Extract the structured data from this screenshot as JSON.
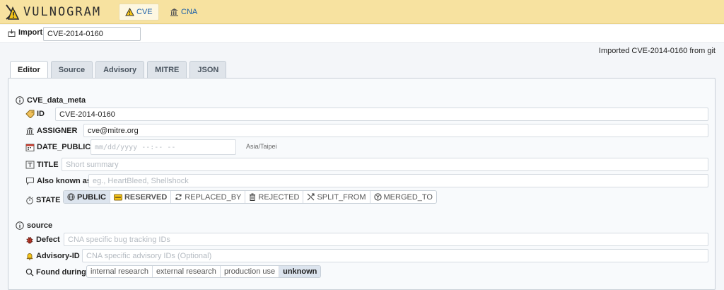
{
  "app": {
    "brand": "VULNOGRAM"
  },
  "nav": [
    {
      "label": "CVE",
      "icon": "warning-icon"
    },
    {
      "label": "CNA",
      "icon": "building-icon"
    }
  ],
  "import": {
    "label": "Import",
    "value": "CVE-2014-0160"
  },
  "status": "Imported CVE-2014-0160 from git",
  "tabs": [
    "Editor",
    "Source",
    "Advisory",
    "MITRE",
    "JSON"
  ],
  "cve_data_meta": {
    "title": "CVE_data_meta",
    "id": {
      "label": "ID",
      "value": "CVE-2014-0160"
    },
    "assigner": {
      "label": "ASSIGNER",
      "value": "cve@mitre.org"
    },
    "date_public": {
      "label": "DATE_PUBLIC",
      "placeholder": "mm/dd/yyyy --:-- --",
      "timezone": "Asia/Taipei"
    },
    "title_field": {
      "label": "TITLE",
      "placeholder": "Short summary"
    },
    "aka": {
      "label": "Also known as",
      "placeholder": "eg., HeartBleed, Shellshock"
    },
    "state": {
      "label": "STATE",
      "options": [
        "PUBLIC",
        "RESERVED",
        "REPLACED_BY",
        "REJECTED",
        "SPLIT_FROM",
        "MERGED_TO"
      ],
      "selected": "PUBLIC"
    }
  },
  "source": {
    "title": "source",
    "defect": {
      "label": "Defect",
      "placeholder": "CNA specific bug tracking IDs"
    },
    "advisory": {
      "label": "Advisory-ID",
      "placeholder": "CNA specific advisory IDs (Optional)"
    },
    "found_during": {
      "label": "Found during",
      "options": [
        "internal research",
        "external research",
        "production use",
        "unknown"
      ],
      "selected": "unknown"
    }
  },
  "colors": {
    "topbar": "#f7e2a0",
    "link": "#1a5fa8",
    "selected_segment": "#dce4ee"
  }
}
